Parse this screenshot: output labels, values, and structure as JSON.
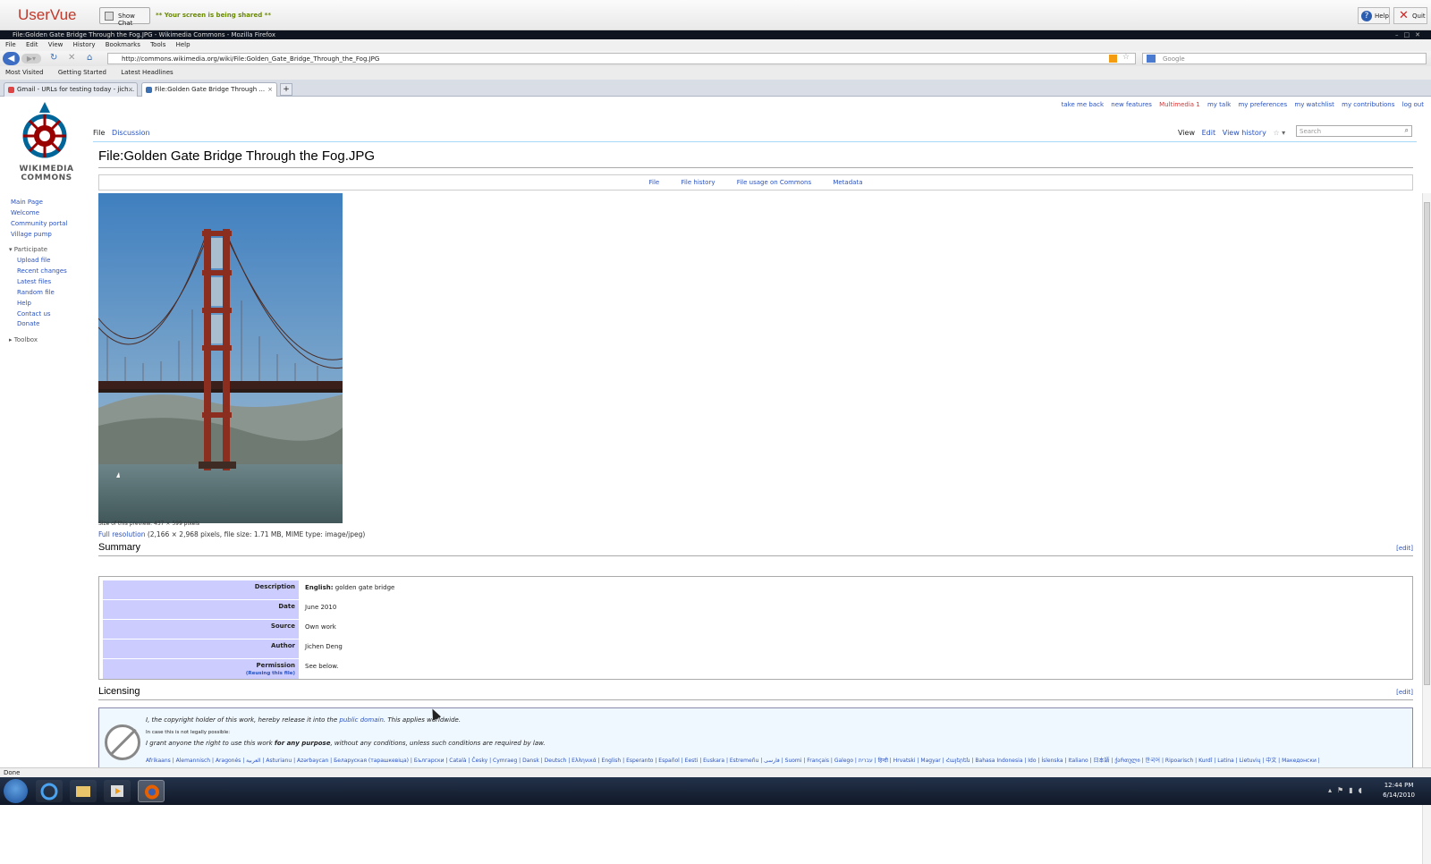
{
  "uservue": {
    "logo": "UserVue",
    "chat_label": "Show Chat",
    "shared_label": "** Your screen is being shared **",
    "help_label": "Help",
    "quit_label": "Quit"
  },
  "window": {
    "title": "File:Golden Gate Bridge Through the Fog.JPG - Wikimedia Commons - Mozilla Firefox"
  },
  "menu": [
    "File",
    "Edit",
    "View",
    "History",
    "Bookmarks",
    "Tools",
    "Help"
  ],
  "nav": {
    "url": "http://commons.wikimedia.org/wiki/File:Golden_Gate_Bridge_Through_the_Fog.JPG",
    "search_placeholder": "Google"
  },
  "bookmarks": [
    "Most Visited",
    "Getting Started",
    "Latest Headlines"
  ],
  "tabs": [
    {
      "label": "Gmail - URLs for testing today - jich...",
      "active": false
    },
    {
      "label": "File:Golden Gate Bridge Through ...",
      "active": true
    }
  ],
  "personal": [
    "take me back",
    "new features",
    "Multimedia 1",
    "my talk",
    "my preferences",
    "my watchlist",
    "my contributions",
    "log out"
  ],
  "logo_text": [
    "WIKIMEDIA",
    "COMMONS"
  ],
  "sidebar": {
    "nav": [
      "Main Page",
      "Welcome",
      "Community portal",
      "Village pump"
    ],
    "participate_header": "Participate",
    "participate": [
      "Upload file",
      "Recent changes",
      "Latest files",
      "Random file",
      "Help",
      "Contact us",
      "Donate"
    ],
    "toolbox": "Toolbox"
  },
  "ns_tabs": [
    "File",
    "Discussion"
  ],
  "view_tabs": [
    "View",
    "Edit",
    "View history"
  ],
  "search_placeholder": "Search",
  "title": "File:Golden Gate Bridge Through the Fog.JPG",
  "file_tabs": [
    "File",
    "File history",
    "File usage on Commons",
    "Metadata"
  ],
  "preview_caption": "Size of this preview: 437 × 599 pixels",
  "full_res": {
    "link": "Full resolution",
    "text": "(2,166 × 2,968 pixels, file size: 1.71 MB, MIME type: image/jpeg)"
  },
  "summary": {
    "heading": "Summary",
    "edit": "[edit]",
    "rows": [
      {
        "label": "Description",
        "value_bold": "English:",
        "value": "golden gate bridge"
      },
      {
        "label": "Date",
        "value_bold": "",
        "value": "June 2010"
      },
      {
        "label": "Source",
        "value_bold": "",
        "value": "Own work"
      },
      {
        "label": "Author",
        "value_bold": "",
        "value": "Jichen Deng"
      },
      {
        "label": "Permission",
        "sub": "(Reusing this file)",
        "value_bold": "",
        "value": "See below."
      }
    ]
  },
  "licensing": {
    "heading": "Licensing",
    "edit": "[edit]",
    "line1_a": "I, the copyright holder of this work, hereby release it into the ",
    "line1_link": "public domain",
    "line1_b": ". This applies worldwide.",
    "line2": "In case this is not legally possible:",
    "line3_a": "I grant anyone the right to use this work ",
    "line3_bold": "for any purpose",
    "line3_b": ", without any conditions, unless such conditions are required by law.",
    "languages": "Afrikaans | Alemannisch | Aragonés | العربية | Asturianu | Azərbaycan | Беларуская (тарашкевіца) | Български | Català | Česky | Cymraeg | Dansk | Deutsch | Ελληνικά | English | Esperanto | Español | Eesti | Euskara | Estremeñu | فارسی | Suomi | Français | Galego | עברית | हिन्दी | Hrvatski | Magyar | Հայերեն | Bahasa Indonesia | Ido | Íslenska | Italiano | 日本語 | ქართული | 한국어 | Ripoarisch | Kurdî | Latina | Lietuvių | 中文 | Македонски |"
  },
  "status": "Done",
  "clock": {
    "time": "12:44 PM",
    "date": "6/14/2010"
  },
  "colors": {
    "link": "#2a52be",
    "label_bg": "#ccccff",
    "license_bg": "#f0f8ff"
  }
}
